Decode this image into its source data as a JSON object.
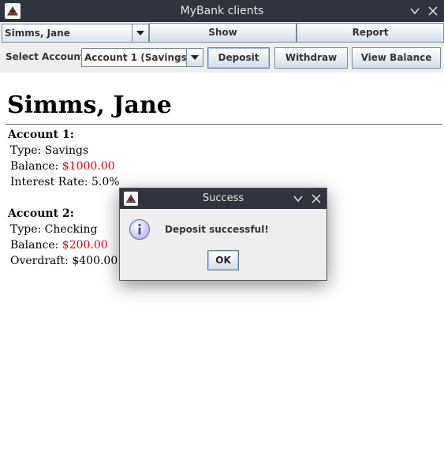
{
  "window": {
    "title": "MyBank clients",
    "app_icon": "java-app-icon",
    "controls": [
      "minimize-icon",
      "close-icon"
    ]
  },
  "toolbar": {
    "client_select": "Simms, Jane",
    "show_label": "Show",
    "report_label": "Report"
  },
  "account_bar": {
    "label": "Select Account:",
    "account_select": "Account 1 (Savings)",
    "deposit_label": "Deposit",
    "withdraw_label": "Withdraw",
    "view_balance_label": "View Balance"
  },
  "client": {
    "name": "Simms, Jane",
    "accounts": [
      {
        "heading": "Account 1:",
        "type_label": "Type:",
        "type": "Savings",
        "balance_label": "Balance:",
        "balance": "$1000.00",
        "extra_label": "Interest Rate:",
        "extra": "5.0%"
      },
      {
        "heading": "Account 2:",
        "type_label": "Type:",
        "type": "Checking",
        "balance_label": "Balance:",
        "balance": "$200.00",
        "extra_label": "Overdraft:",
        "extra": "$400.00"
      }
    ]
  },
  "dialog": {
    "title": "Success",
    "icon": "info-icon",
    "message": "Deposit successful!",
    "ok_label": "OK"
  },
  "colors": {
    "titlebar": "#2f343f",
    "balance": "#e00000",
    "panel": "#eeeeee"
  }
}
